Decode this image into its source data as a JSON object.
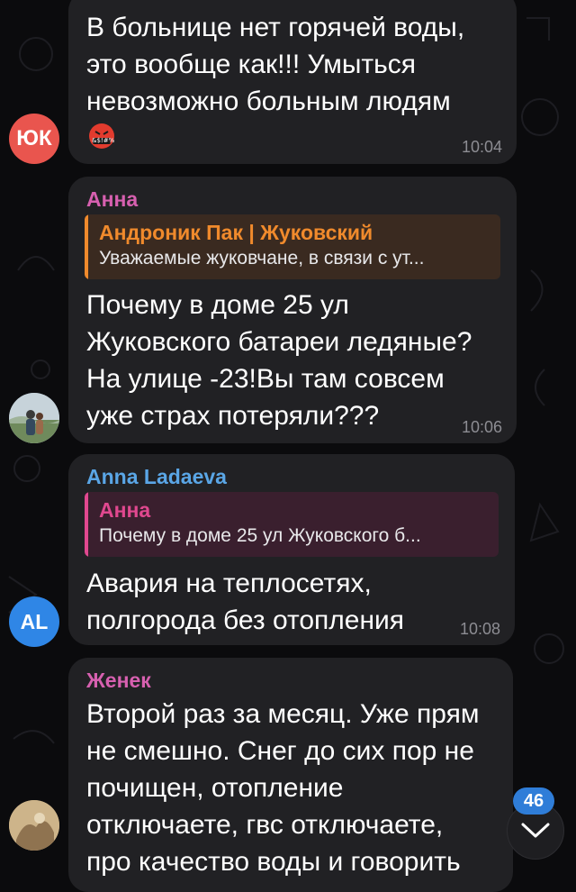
{
  "colors": {
    "bubble": "#212124",
    "time": "#8d8d93",
    "anna_name": "#d760b0",
    "anna_ladaeva_name": "#5aa6e6",
    "zhenek_name": "#d760b0",
    "reply_orange": "#f08a2c",
    "reply_pink": "#e0488f",
    "avatar_yuk": "#e9554e",
    "avatar_al": "#2f86e6",
    "badge": "#2f7dd8"
  },
  "messages": [
    {
      "id": "m1",
      "lines": [
        "В больнице нет горячей воды,",
        "это вообще как!!! Умыться",
        "невозможно больным людям"
      ],
      "emoji": "&$!#%",
      "time": "10:04",
      "avatar": {
        "type": "initials",
        "text": "ЮК"
      }
    },
    {
      "id": "m2",
      "sender": "Анна",
      "reply": {
        "name": "Андроник Пак | Жуковский",
        "text": "Уважаемые жуковчане, в связи с ут..."
      },
      "lines": [
        "Почему в доме 25 ул",
        "Жуковского батареи ледяные?",
        "На улице -23!Вы там совсем",
        "уже страх потеряли???"
      ],
      "time": "10:06",
      "avatar": {
        "type": "photo",
        "icon": "user-photo-icon"
      }
    },
    {
      "id": "m3",
      "sender": "Anna Ladaeva",
      "reply": {
        "name": "Анна",
        "text": "Почему в доме 25 ул Жуковского б..."
      },
      "lines": [
        "Авария на теплосетях,",
        "полгорода без отопления"
      ],
      "time": "10:08",
      "avatar": {
        "type": "initials",
        "text": "AL"
      }
    },
    {
      "id": "m4",
      "sender": "Женек",
      "lines": [
        "Второй раз за месяц. Уже прям",
        "не смешно. Снег до сих пор не",
        "почищен, отопление",
        "отключаете, гвс отключаете,",
        "про качество воды и говорить"
      ],
      "avatar": {
        "type": "photo",
        "icon": "user-photo-icon"
      }
    }
  ],
  "unread_count": "46",
  "scroll_icon": "chevron-down-icon"
}
